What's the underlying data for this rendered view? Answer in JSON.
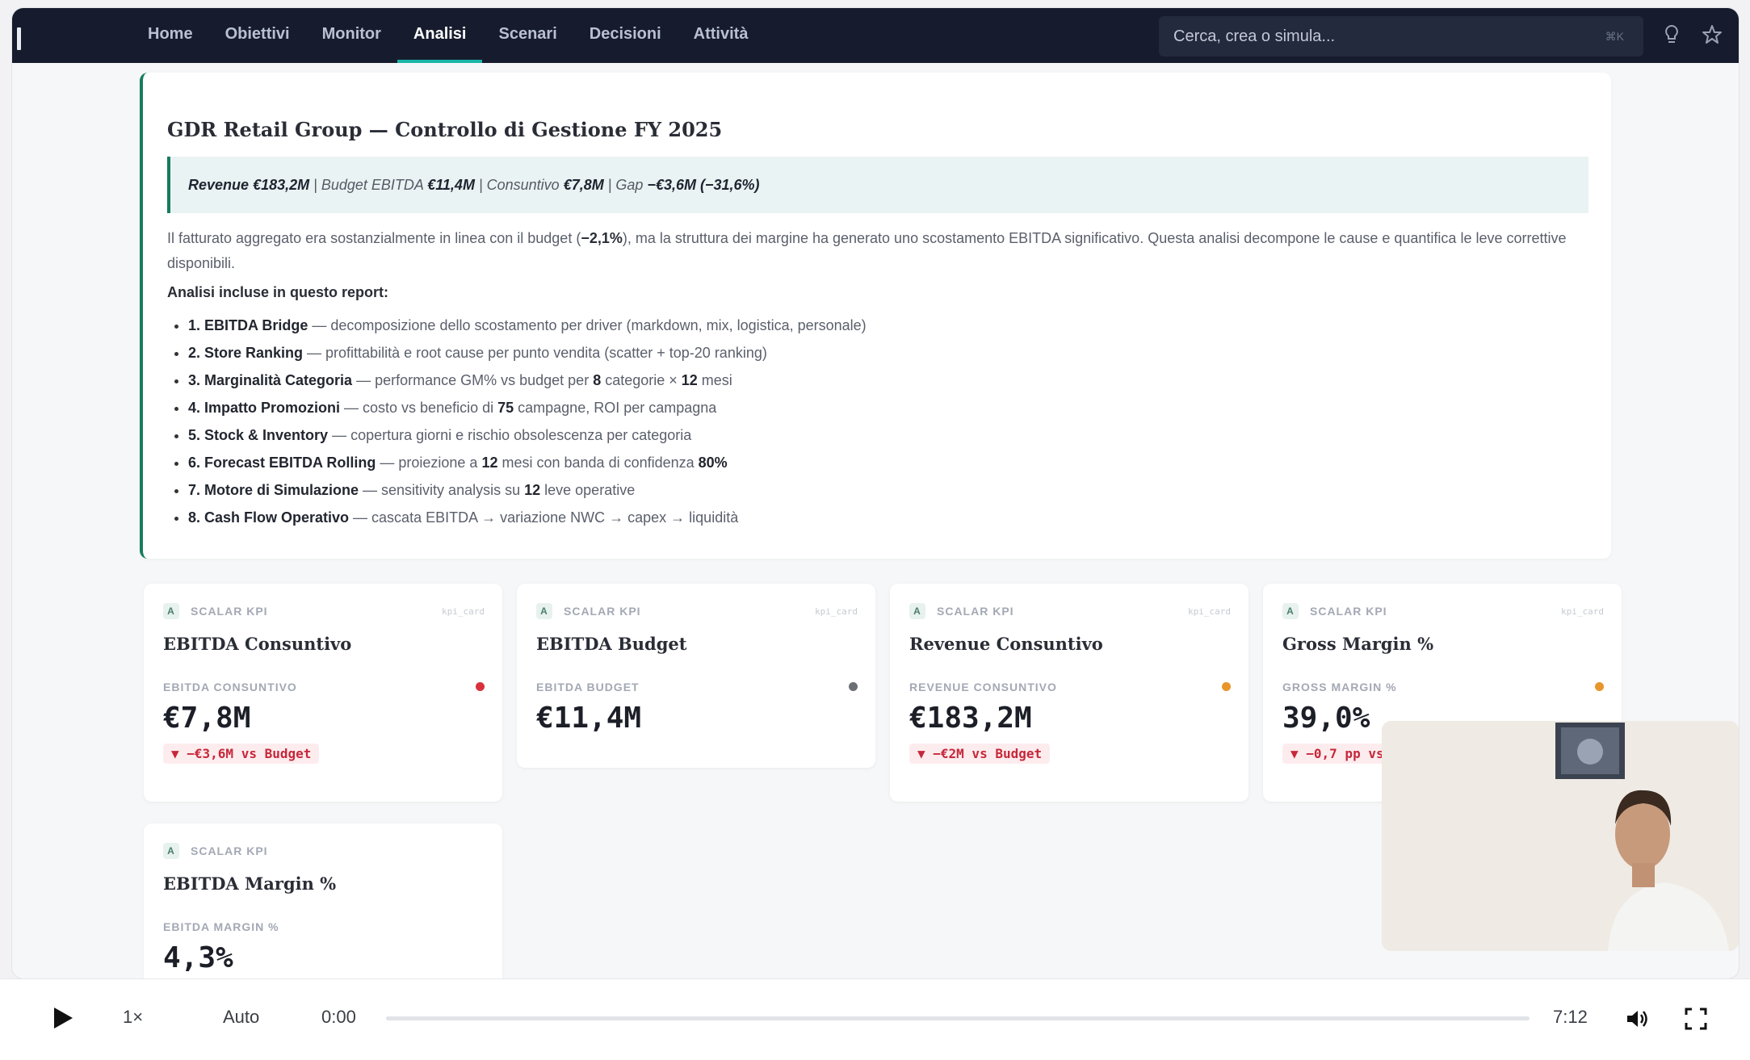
{
  "nav": {
    "items": [
      {
        "label": "Home"
      },
      {
        "label": "Obiettivi"
      },
      {
        "label": "Monitor"
      },
      {
        "label": "Analisi"
      },
      {
        "label": "Scenari"
      },
      {
        "label": "Decisioni"
      },
      {
        "label": "Attività"
      }
    ],
    "active_index": 3,
    "search_placeholder": "Cerca, crea o simula...",
    "search_shortcut": "⌘K",
    "icons": [
      "lightbulb-icon",
      "star-icon"
    ]
  },
  "report": {
    "title": "GDR Retail Group — Controllo di Gestione FY 2025",
    "summary": {
      "revenue_label": "Revenue",
      "revenue_value": "€183,2M",
      "budget_label": "Budget EBITDA",
      "budget_value": "€11,4M",
      "consuntivo_label": "Consuntivo",
      "consuntivo_value": "€7,8M",
      "gap_label": "Gap",
      "gap_value": "−€3,6M (−31,6%)"
    },
    "paragraph_a": "Il fatturato aggregato era sostanzialmente in linea con il budget (",
    "paragraph_bold": "−2,1%",
    "paragraph_b": "), ma la struttura dei margine ha generato uno scostamento EBITDA significativo. Questa analisi decompone le cause e quantifica le leve correttive disponibili.",
    "analyses_heading": "Analisi incluse in questo report:",
    "analyses": [
      {
        "name": "1. EBITDA Bridge",
        "desc": " — decomposizione dello scostamento per driver (markdown, mix, logistica, personale)"
      },
      {
        "name": "2. Store Ranking",
        "desc": " — profittabilità e root cause per punto vendita (scatter + top-20 ranking)"
      },
      {
        "name": "3. Marginalità Categoria",
        "desc_a": " — performance GM% vs budget per ",
        "n1": "8",
        "desc_b": " categorie × ",
        "n2": "12",
        "desc_c": " mesi"
      },
      {
        "name": "4. Impatto Promozioni",
        "desc_a": " — costo vs beneficio di ",
        "n1": "75",
        "desc_b": " campagne, ROI per campagna"
      },
      {
        "name": "5. Stock & Inventory",
        "desc": " — copertura giorni e rischio obsolescenza per categoria"
      },
      {
        "name": "6. Forecast EBITDA Rolling",
        "desc_a": " — proiezione a ",
        "n1": "12",
        "desc_b": " mesi con banda di confidenza ",
        "n2": "80%"
      },
      {
        "name": "7. Motore di Simulazione",
        "desc_a": " — sensitivity analysis su ",
        "n1": "12",
        "desc_b": " leve operative"
      },
      {
        "name": "8. Cash Flow Operativo",
        "desc": " — cascata EBITDA → variazione NWC → capex → liquidità"
      }
    ]
  },
  "kpis": [
    {
      "badge": "A",
      "tag": "SCALAR KPI",
      "code": "kpi_card",
      "title": "EBITDA Consuntivo",
      "metric": "EBITDA CONSUNTIVO",
      "value": "€7,8M",
      "delta": "▼ −€3,6M vs Budget",
      "status_color": "#d9303e"
    },
    {
      "badge": "A",
      "tag": "SCALAR KPI",
      "code": "kpi_card",
      "title": "EBITDA Budget",
      "metric": "EBITDA BUDGET",
      "value": "€11,4M",
      "delta": "",
      "status_color": "#6b6e75"
    },
    {
      "badge": "A",
      "tag": "SCALAR KPI",
      "code": "kpi_card",
      "title": "Revenue Consuntivo",
      "metric": "REVENUE CONSUNTIVO",
      "value": "€183,2M",
      "delta": "▼ −€2M vs Budget",
      "status_color": "#e8952a"
    },
    {
      "badge": "A",
      "tag": "SCALAR KPI",
      "code": "kpi_card",
      "title": "Gross Margin %",
      "metric": "GROSS MARGIN %",
      "value": "39,0%",
      "delta": "▼ −0,7 pp vs",
      "status_color": "#e8952a"
    },
    {
      "badge": "A",
      "tag": "SCALAR KPI",
      "code": "kpi_card",
      "title": "EBITDA Margin %",
      "metric": "EBITDA MARGIN %",
      "value": "4,3%",
      "delta": "",
      "status_color": ""
    }
  ],
  "player": {
    "speed": "1×",
    "quality": "Auto",
    "current_time": "0:00",
    "duration": "7:12",
    "progress": 0,
    "icons": [
      "play-icon",
      "volume-icon",
      "fullscreen-icon"
    ]
  },
  "colors": {
    "nav_bg": "#161c2d",
    "accent": "#1bb5a6",
    "report_border": "#167c5e",
    "negative": "#c62839"
  }
}
